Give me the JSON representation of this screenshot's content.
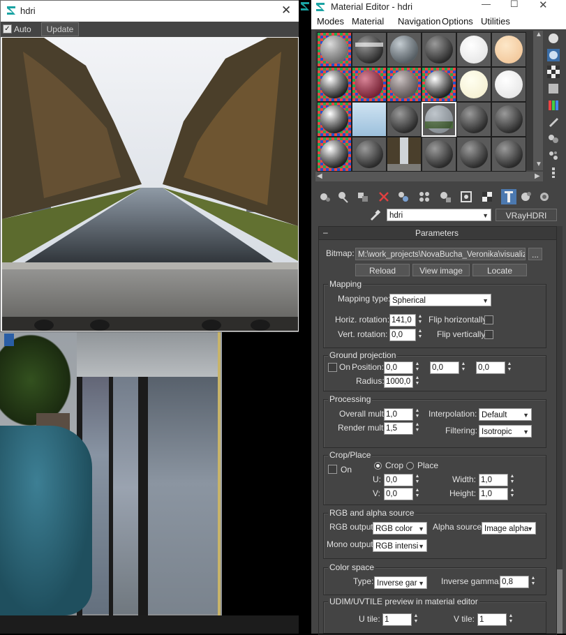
{
  "hdri_window": {
    "title": "hdri",
    "auto_label": "Auto",
    "update_label": "Update"
  },
  "material_editor": {
    "title": "Material Editor - hdri",
    "menu": [
      "Modes",
      "Material",
      "Navigation",
      "Options",
      "Utilities"
    ],
    "material_name": "hdri",
    "material_type": "VRayHDRI",
    "rollout_title": "Parameters",
    "bitmap": {
      "label": "Bitmap:",
      "path": "M:\\work_projects\\NovaBucha_Veronika\\visualizati",
      "browse": "...",
      "reload": "Reload",
      "view_image": "View image",
      "locate": "Locate"
    },
    "mapping": {
      "title": "Mapping",
      "type_label": "Mapping type:",
      "type_value": "Spherical",
      "horiz_label": "Horiz. rotation:",
      "horiz_value": "141,0",
      "flip_h": "Flip horizontally",
      "vert_label": "Vert. rotation:",
      "vert_value": "0,0",
      "flip_v": "Flip vertically"
    },
    "ground": {
      "title": "Ground projection",
      "on_label": "On",
      "position_label": "Position:",
      "pos_x": "0,0",
      "pos_y": "0,0",
      "pos_z": "0,0",
      "radius_label": "Radius:",
      "radius_value": "1000,0"
    },
    "processing": {
      "title": "Processing",
      "overall_label": "Overall mult:",
      "overall_value": "1,0",
      "render_label": "Render mult:",
      "render_value": "1,5",
      "interp_label": "Interpolation:",
      "interp_value": "Default",
      "filter_label": "Filtering:",
      "filter_value": "Isotropic"
    },
    "crop": {
      "title": "Crop/Place",
      "on_label": "On",
      "crop_label": "Crop",
      "place_label": "Place",
      "u_label": "U:",
      "u_value": "0,0",
      "v_label": "V:",
      "v_value": "0,0",
      "width_label": "Width:",
      "width_value": "1,0",
      "height_label": "Height:",
      "height_value": "1,0"
    },
    "rgb": {
      "title": "RGB and alpha source",
      "rgb_label": "RGB output:",
      "rgb_value": "RGB color",
      "alpha_label": "Alpha source:",
      "alpha_value": "Image alpha",
      "mono_label": "Mono output:",
      "mono_value": "RGB intensi"
    },
    "color_space": {
      "title": "Color space",
      "type_label": "Type:",
      "type_value": "Inverse gar",
      "gamma_label": "Inverse gamma:",
      "gamma_value": "0,8"
    },
    "udim": {
      "title": "UDIM/UVTILE preview in material editor",
      "u_label": "U tile:",
      "u_value": "1",
      "v_label": "V tile:",
      "v_value": "1"
    }
  }
}
